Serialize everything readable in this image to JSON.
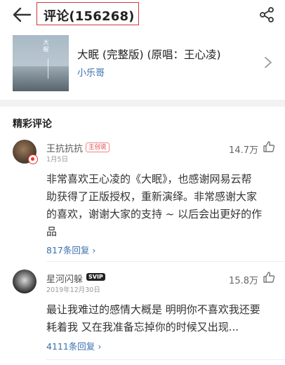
{
  "header": {
    "title": "评论(156268)"
  },
  "song": {
    "name": "大眠 (完整版) (原唱：王心凌)",
    "artist": "小乐哥",
    "cover_text": "大眠"
  },
  "section_title": "精彩评论",
  "comments": [
    {
      "user": "王抗抗抗",
      "tag": "主创说",
      "date": "1月5日",
      "likes": "14.7万",
      "lines": [
        "非常喜欢王心凌的《大眠》，也感谢网易云帮",
        "助获得了正版授权，重新演绎。非常感谢大家",
        "的喜欢，谢谢大家的支持 ~ 以后会出更好的作",
        "品"
      ],
      "replies": "817条回复"
    },
    {
      "user": "星河闪躲",
      "tag": "SVIP",
      "date": "2019年12月30日",
      "likes": "15.8万",
      "lines": [
        "最让我难过的感情大概是 明明你不喜欢我还要",
        "耗着我 又在我准备忘掉你的时候又出现..."
      ],
      "replies": "4111条回复"
    }
  ],
  "colors": {
    "accent_red": "#d0393e",
    "link_blue": "#3a6fb0"
  }
}
